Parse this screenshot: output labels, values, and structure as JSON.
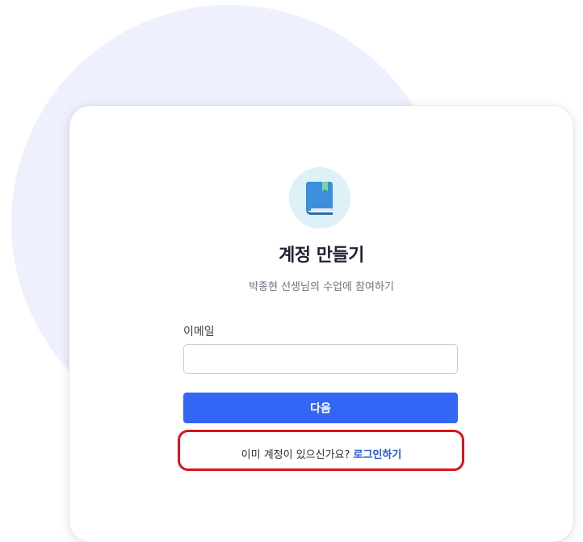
{
  "signup": {
    "logo_icon": "book-icon",
    "title": "계정 만들기",
    "subtitle": "박종현 선생님의 수업에 참여하기",
    "email_label": "이메일",
    "email_value": "",
    "email_placeholder": "",
    "next_button_label": "다음",
    "login_prompt_text": "이미 계정이 있으신가요?",
    "login_link_label": "로그인하기"
  },
  "colors": {
    "primary": "#3466f6",
    "link": "#2556d8",
    "background_circle": "#eef0fd",
    "logo_background": "#ddf1f6",
    "highlight": "#d8151c"
  }
}
